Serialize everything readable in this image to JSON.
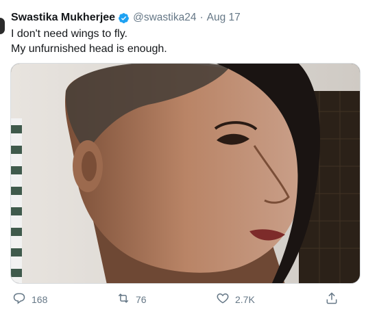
{
  "tweet": {
    "author_name": "Swastika Mukherjee",
    "handle": "@swastika24",
    "separator": "·",
    "date": "Aug 17",
    "lines": [
      "I don't need wings to fly.",
      "My unfurnished head is enough."
    ],
    "media_image": "woman-with-shaved-head-side-profile"
  },
  "actions": {
    "reply_count": "168",
    "retweet_count": "76",
    "like_count": "2.7K"
  },
  "colors": {
    "verified": "#1da1f2",
    "text": "#14171a",
    "muted": "#657786"
  }
}
